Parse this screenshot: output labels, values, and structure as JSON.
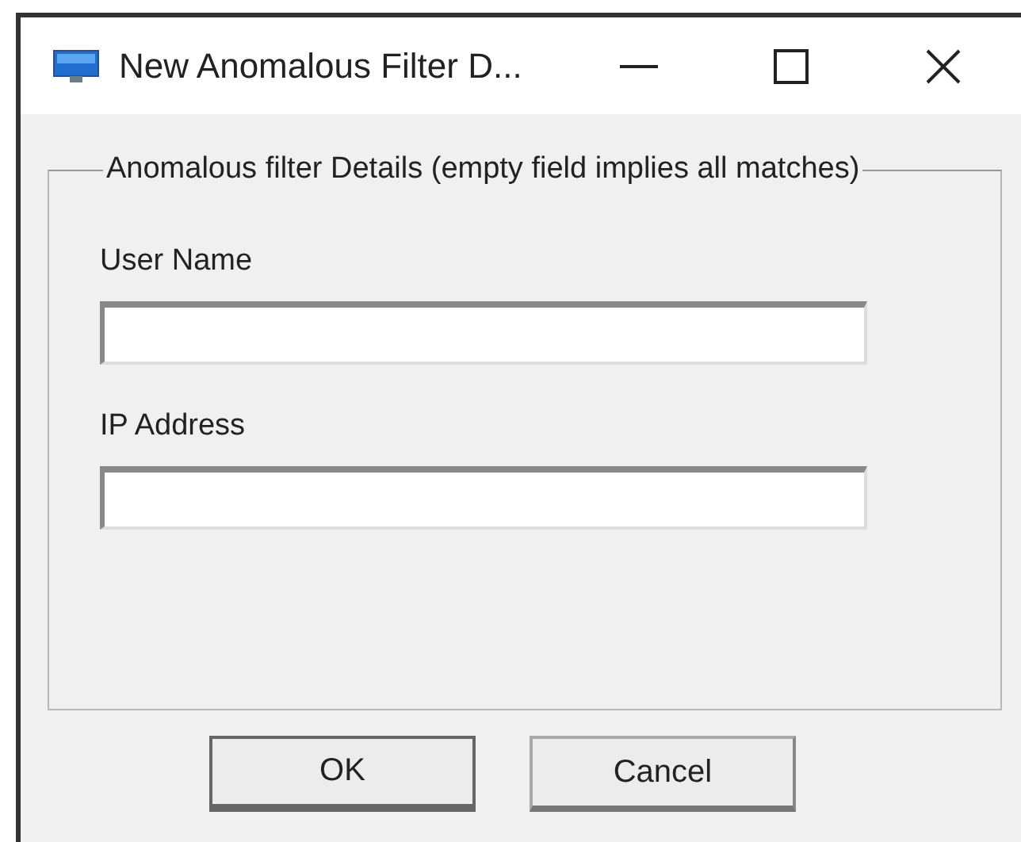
{
  "window": {
    "title": "New Anomalous Filter D..."
  },
  "group": {
    "legend": "Anomalous filter Details (empty field implies all matches)"
  },
  "fields": [
    {
      "label": "User Name"
    },
    {
      "label": "IP Address"
    }
  ],
  "buttons": [
    "OK",
    "Cancel"
  ]
}
